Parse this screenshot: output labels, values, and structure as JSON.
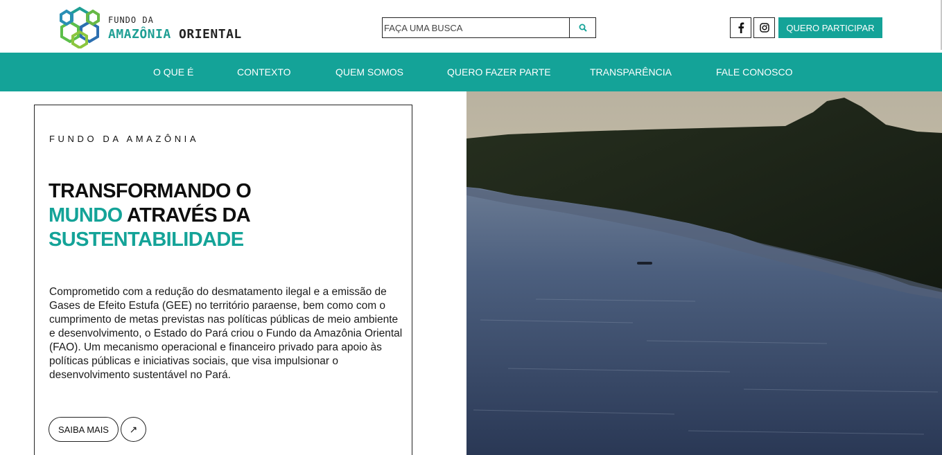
{
  "header": {
    "logo": {
      "line1": "FUNDO DA",
      "line2_word1": "AMAZÔNIA",
      "line2_word2": "ORIENTAL"
    },
    "search": {
      "placeholder": "FAÇA UMA BUSCA",
      "value": ""
    },
    "social": [
      {
        "icon": "facebook-icon"
      },
      {
        "icon": "instagram-icon"
      }
    ],
    "cta_label": "QUERO PARTICIPAR"
  },
  "nav": {
    "items": [
      {
        "label": "O QUE É"
      },
      {
        "label": "CONTEXTO"
      },
      {
        "label": "QUEM SOMOS"
      },
      {
        "label": "QUERO FAZER PARTE"
      },
      {
        "label": "TRANSPARÊNCIA"
      },
      {
        "label": "FALE CONOSCO"
      }
    ]
  },
  "hero": {
    "eyebrow": "FUNDO DA AMAZÔNIA",
    "headline": {
      "part1": "TRANSFORMANDO O",
      "part2_teal": "MUNDO",
      "part3": " ATRAVÉS DA",
      "part4_teal": "SUSTENTABILIDADE"
    },
    "description": "Comprometido com a redução do desmatamento ilegal e a emissão de Gases de Efeito Estufa (GEE) no território paraense, bem como com o cumprimento de metas previstas nas políticas públicas de meio ambiente e desenvolvimento, o Estado do Pará criou o Fundo da Amazônia Oriental (FAO). Um mecanismo operacional e financeiro privado para apoio às políticas públicas e iniciativas sociais, que visa impulsionar o desenvolvimento sustentável no Pará.",
    "more_label": "SAIBA MAIS",
    "arrow_glyph": "↗"
  },
  "colors": {
    "accent": "#14a398",
    "text": "#111111"
  }
}
